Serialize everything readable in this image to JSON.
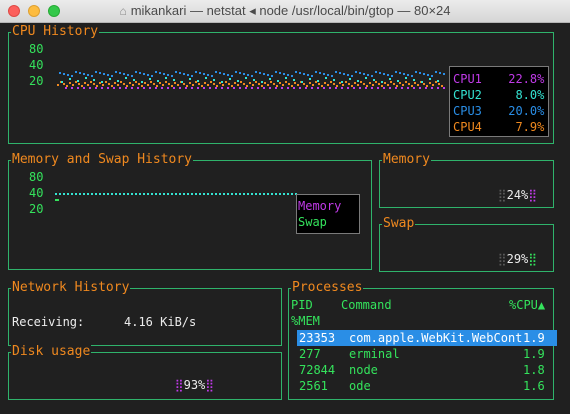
{
  "window": {
    "title": "mikankari — netstat ◂ node /usr/local/bin/gtop — 80×24",
    "home_icon": "home-icon"
  },
  "colors": {
    "border": "#2fb36b",
    "title": "#f0891f",
    "cpu1": "#c03ae8",
    "cpu2": "#34e3d2",
    "cpu3": "#2a8ee6",
    "cpu4": "#f0891f",
    "memory": "#c03ae8",
    "swap": "#34e35c",
    "selection": "#2a8ee6"
  },
  "cpu": {
    "title": "CPU History",
    "y_labels": [
      "80",
      "40",
      "20"
    ],
    "legend": [
      {
        "name": "CPU1",
        "value": "22.8%"
      },
      {
        "name": "CPU2",
        "value": "8.0%"
      },
      {
        "name": "CPU3",
        "value": "20.0%"
      },
      {
        "name": "CPU4",
        "value": "7.9%"
      }
    ]
  },
  "mem_history": {
    "title": "Memory and Swap History",
    "y_labels": [
      "80",
      "40",
      "20"
    ],
    "legend": [
      {
        "name": "Memory"
      },
      {
        "name": "Swap"
      }
    ]
  },
  "memory": {
    "title": "Memory",
    "percent": "24%",
    "fraction": 0.24
  },
  "swap": {
    "title": "Swap",
    "percent": "29%",
    "fraction": 0.29
  },
  "network": {
    "title": "Network History",
    "receiving_label": "Receiving:",
    "receiving_value": "4.16 KiB/s"
  },
  "disk": {
    "title": "Disk usage",
    "percent": "93%",
    "fraction": 0.93
  },
  "processes": {
    "title": "Processes",
    "headers": {
      "pid": "PID",
      "command": "Command",
      "cpu": "%CPU▲",
      "mem": "%MEM"
    },
    "rows": [
      {
        "pid": "23353",
        "command": "com.apple.WebKit.WebCont",
        "cpu": "1.9"
      },
      {
        "pid": "277",
        "command": "erminal",
        "cpu": "1.9"
      },
      {
        "pid": "72844",
        "command": "node",
        "cpu": "1.8"
      },
      {
        "pid": "2561",
        "command": "ode",
        "cpu": "1.6"
      }
    ]
  }
}
